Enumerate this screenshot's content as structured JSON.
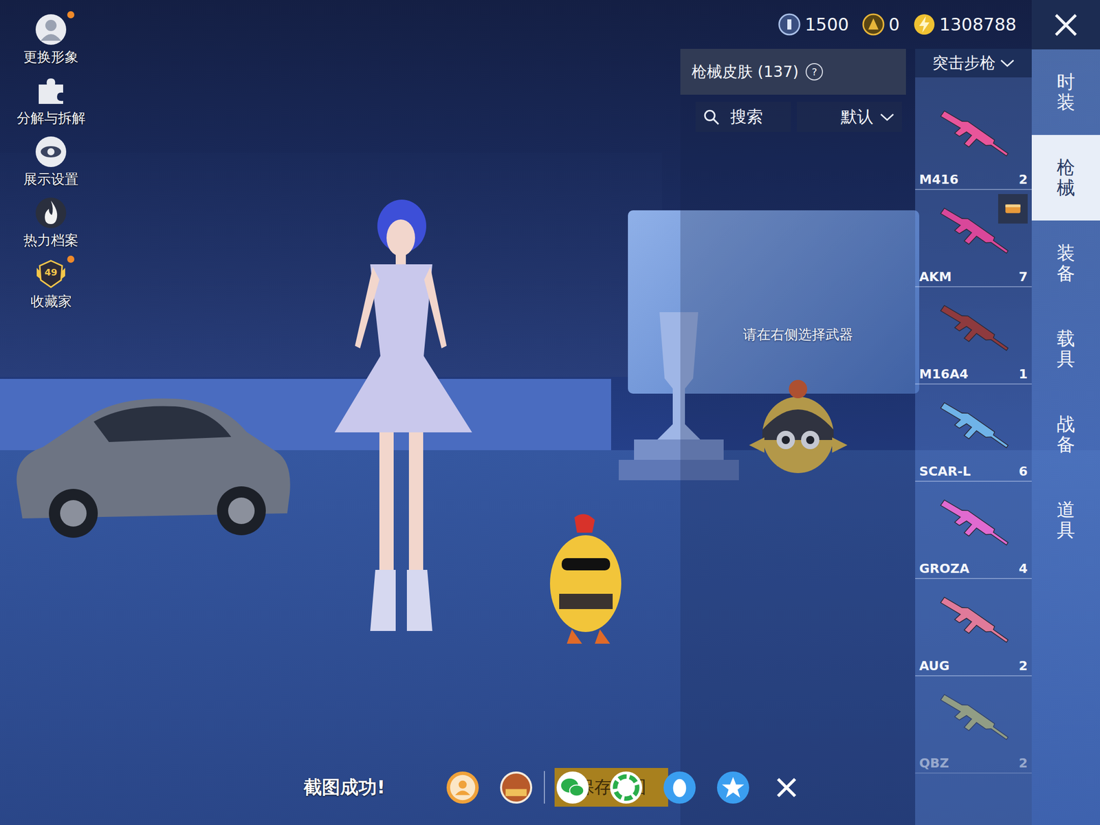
{
  "top_bar": {
    "currencies": [
      {
        "kind": "silver",
        "value": "1500"
      },
      {
        "kind": "gold",
        "value": "0"
      },
      {
        "kind": "bolt",
        "value": "1308788"
      }
    ]
  },
  "side_menu": [
    {
      "label": "更换形象",
      "icon": "person",
      "dot": true,
      "badge": ""
    },
    {
      "label": "分解与拆解",
      "icon": "puzzle",
      "dot": false,
      "badge": ""
    },
    {
      "label": "展示设置",
      "icon": "eye",
      "dot": false,
      "badge": ""
    },
    {
      "label": "热力档案",
      "icon": "flame",
      "dot": false,
      "badge": ""
    },
    {
      "label": "收藏家",
      "icon": "medal",
      "dot": true,
      "badge": "49"
    }
  ],
  "skins_panel": {
    "title": "枪械皮肤 (137)",
    "help": "?",
    "search": {
      "placeholder": "搜索"
    },
    "sort": {
      "value": "默认"
    },
    "hint": "请在右侧选择武器"
  },
  "category": {
    "value": "突击步枪"
  },
  "weapons": [
    {
      "name": "M416",
      "count": "2",
      "color": "#e8559a",
      "badge": false,
      "faded": false
    },
    {
      "name": "AKM",
      "count": "7",
      "color": "#d9479a",
      "badge": true,
      "faded": false
    },
    {
      "name": "M16A4",
      "count": "1",
      "color": "#8e3a3e",
      "badge": false,
      "faded": false
    },
    {
      "name": "SCAR-L",
      "count": "6",
      "color": "#6fb3e8",
      "badge": false,
      "faded": false
    },
    {
      "name": "GROZA",
      "count": "4",
      "color": "#e06ad0",
      "badge": false,
      "faded": false
    },
    {
      "name": "AUG",
      "count": "2",
      "color": "#e07a9a",
      "badge": false,
      "faded": false
    },
    {
      "name": "QBZ",
      "count": "2",
      "color": "#e6dd6a",
      "badge": false,
      "faded": true
    }
  ],
  "tabs": [
    {
      "label": "时装",
      "selected": false
    },
    {
      "label": "枪械",
      "selected": true
    },
    {
      "label": "装备",
      "selected": false
    },
    {
      "label": "载具",
      "selected": false
    },
    {
      "label": "战备",
      "selected": false
    },
    {
      "label": "道具",
      "selected": false
    }
  ],
  "share_bar": {
    "toast": "截图成功!",
    "save_button": "保存截图",
    "targets": [
      {
        "kind": "profile"
      },
      {
        "kind": "game"
      },
      {
        "kind": "wechat"
      },
      {
        "kind": "moments"
      },
      {
        "kind": "qq"
      },
      {
        "kind": "qzone"
      },
      {
        "kind": "close"
      }
    ]
  }
}
